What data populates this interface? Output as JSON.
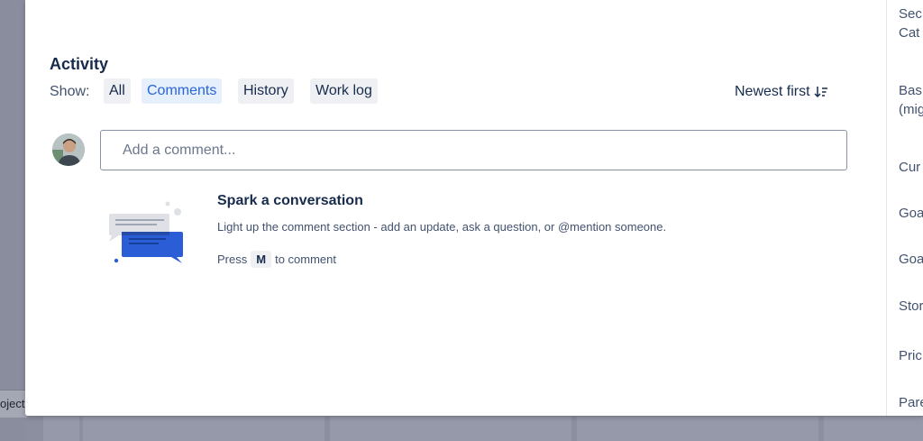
{
  "activity": {
    "title": "Activity",
    "show_label": "Show:",
    "filters": [
      {
        "label": "All",
        "active": false
      },
      {
        "label": "Comments",
        "active": true
      },
      {
        "label": "History",
        "active": false
      },
      {
        "label": "Work log",
        "active": false
      }
    ],
    "sort_label": "Newest first"
  },
  "comment": {
    "placeholder": "Add a comment..."
  },
  "empty_state": {
    "title": "Spark a conversation",
    "description": "Light up the comment section - add an update, ask a question, or @mention someone.",
    "press_prefix": "Press",
    "key": "M",
    "press_suffix": "to comment"
  },
  "right_panel": {
    "items": [
      "Sec",
      "Cat",
      "Bas",
      "(mig",
      "Cur",
      "Goa",
      "Goa",
      "Stor",
      "Pric",
      "Pare"
    ]
  },
  "background": {
    "project_label": "oject"
  },
  "colors": {
    "accent": "#2865d8",
    "text_primary": "#172b4d",
    "text_secondary": "#42526e",
    "overlay": "#8c8fa0"
  }
}
